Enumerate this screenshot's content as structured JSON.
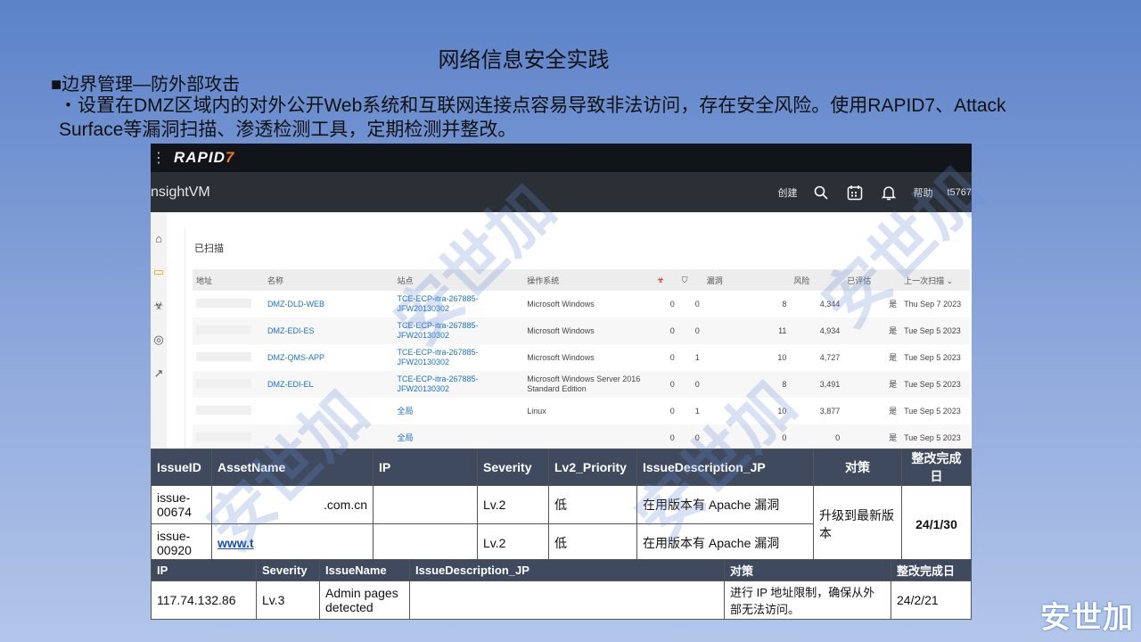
{
  "slide": {
    "title": "网络信息安全实践",
    "bullet_head": "■边界管理—防外部攻击",
    "bullet_text": "・设置在DMZ区域内的对外公开Web系统和互联网连接点容易导致非法访问，存在安全风险。使用RAPID7、Attack Surface等漏洞扫描、渗透检测工具，定期检测并整改。",
    "brand": "安世加",
    "watermark": "安世加"
  },
  "app": {
    "logo": "RAPID",
    "logo_mark": "7",
    "product": "nsightVM",
    "create": "创建",
    "help": "帮助",
    "user": "t5767",
    "icons": [
      "search-icon",
      "calendar-icon",
      "bell-icon"
    ],
    "panel_title": "已扫描",
    "columns": [
      "地址",
      "名称",
      "站点",
      "操作系统",
      "",
      "",
      "漏洞",
      "风险",
      "已评估",
      "上一次扫描 ⌄"
    ],
    "rows": [
      {
        "name": "DMZ-DLD-WEB",
        "site": "TCE-ECP-itra-267885-JFW20130302",
        "os": "Microsoft Windows",
        "a": "0",
        "b": "0",
        "vuln": "8",
        "risk": "4,344",
        "assessed": "是",
        "last": "Thu Sep 7 2023"
      },
      {
        "name": "DMZ-EDI-ES",
        "site": "TCE-ECP-itra-267885-JFW20130302",
        "os": "Microsoft Windows",
        "a": "0",
        "b": "0",
        "vuln": "11",
        "risk": "4,934",
        "assessed": "是",
        "last": "Tue Sep 5 2023"
      },
      {
        "name": "DMZ-QMS-APP",
        "site": "TCE-ECP-itra-267885-JFW20130302",
        "os": "Microsoft Windows",
        "a": "0",
        "b": "1",
        "vuln": "10",
        "risk": "4,727",
        "assessed": "是",
        "last": "Tue Sep 5 2023"
      },
      {
        "name": "DMZ-EDI-EL",
        "site": "TCE-ECP-itra-267885-JFW20130302",
        "os": "Microsoft Windows Server 2016 Standard Edition",
        "a": "0",
        "b": "0",
        "vuln": "8",
        "risk": "3,491",
        "assessed": "是",
        "last": "Tue Sep 5 2023"
      },
      {
        "name": "",
        "site": "全局",
        "os": "Linux",
        "a": "0",
        "b": "1",
        "vuln": "10",
        "risk": "3,877",
        "assessed": "是",
        "last": "Tue Sep 5 2023"
      },
      {
        "name": "",
        "site": "全局",
        "os": "",
        "a": "0",
        "b": "0",
        "vuln": "0",
        "risk": "0",
        "assessed": "是",
        "last": "Tue Sep 5 2023"
      }
    ]
  },
  "issues": {
    "headers": [
      "IssueID",
      "AssetName",
      "IP",
      "Severity",
      "Lv2_Priority",
      "IssueDescription_JP",
      "对策",
      "整改完成日"
    ],
    "rows": [
      {
        "id": "issue-00674",
        "asset": ".com.cn",
        "ip": "",
        "severity": "Lv.2",
        "priority": "低",
        "desc": "在用版本有 Apache 漏洞",
        "measure": "升级到最新版本",
        "date": "24/1/30"
      },
      {
        "id": "issue-00920",
        "asset": "www.t",
        "ip": "",
        "severity": "Lv.2",
        "priority": "低",
        "desc": "在用版本有 Apache 漏洞"
      }
    ]
  },
  "issues2": {
    "headers": [
      "IP",
      "Severity",
      "IssueName",
      "IssueDescription_JP",
      "对策",
      "整改完成日"
    ],
    "row": {
      "ip": "117.74.132.86",
      "severity": "Lv.3",
      "name": "Admin pages detected",
      "desc": "",
      "measure": "进行 IP 地址限制，确保从外部无法访问。",
      "date": "24/2/21"
    }
  }
}
